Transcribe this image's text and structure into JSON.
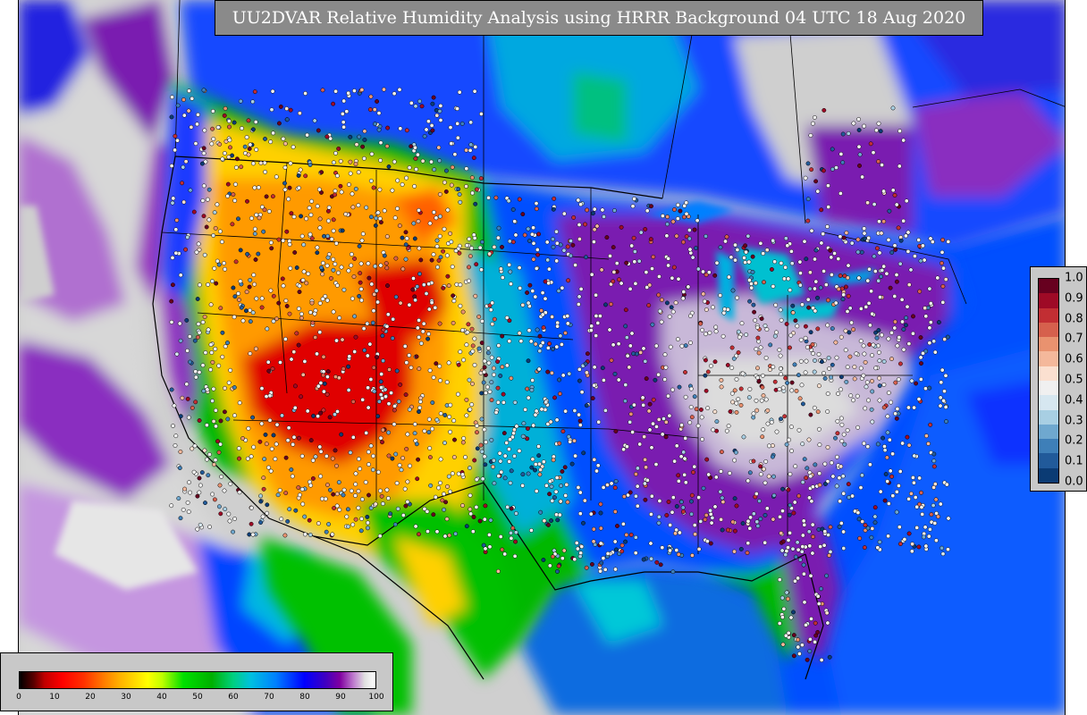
{
  "title": "UU2DVAR Relative Humidity Analysis using HRRR Background 04 UTC 18 Aug 2020",
  "rh_colorbar": {
    "ticks": [
      "0",
      "10",
      "20",
      "30",
      "40",
      "50",
      "60",
      "70",
      "80",
      "90",
      "100"
    ]
  },
  "stdev_legend": {
    "ticks": [
      "1.0",
      "0.9",
      "0.8",
      "0.7",
      "0.6",
      "0.5",
      "0.4",
      "0.3",
      "0.2",
      "0.1",
      "0.0"
    ],
    "colors": [
      "#67001f",
      "#9e0a26",
      "#c22e33",
      "#d6604d",
      "#e9926f",
      "#f4b89b",
      "#fbe0d0",
      "#f0f0f0",
      "#d6e7f0",
      "#a8cfe3",
      "#6fa8cf",
      "#3e7fb8",
      "#215a9a",
      "#0b3b74"
    ]
  },
  "colors": {
    "dry_red": "#e00000",
    "orange": "#ff9000",
    "yellow": "#ffff00",
    "green": "#00c000",
    "cyan": "#00b0d8",
    "blue": "#0050ff",
    "purple": "#7a00b0",
    "land_missing": "#cfcfcf"
  }
}
